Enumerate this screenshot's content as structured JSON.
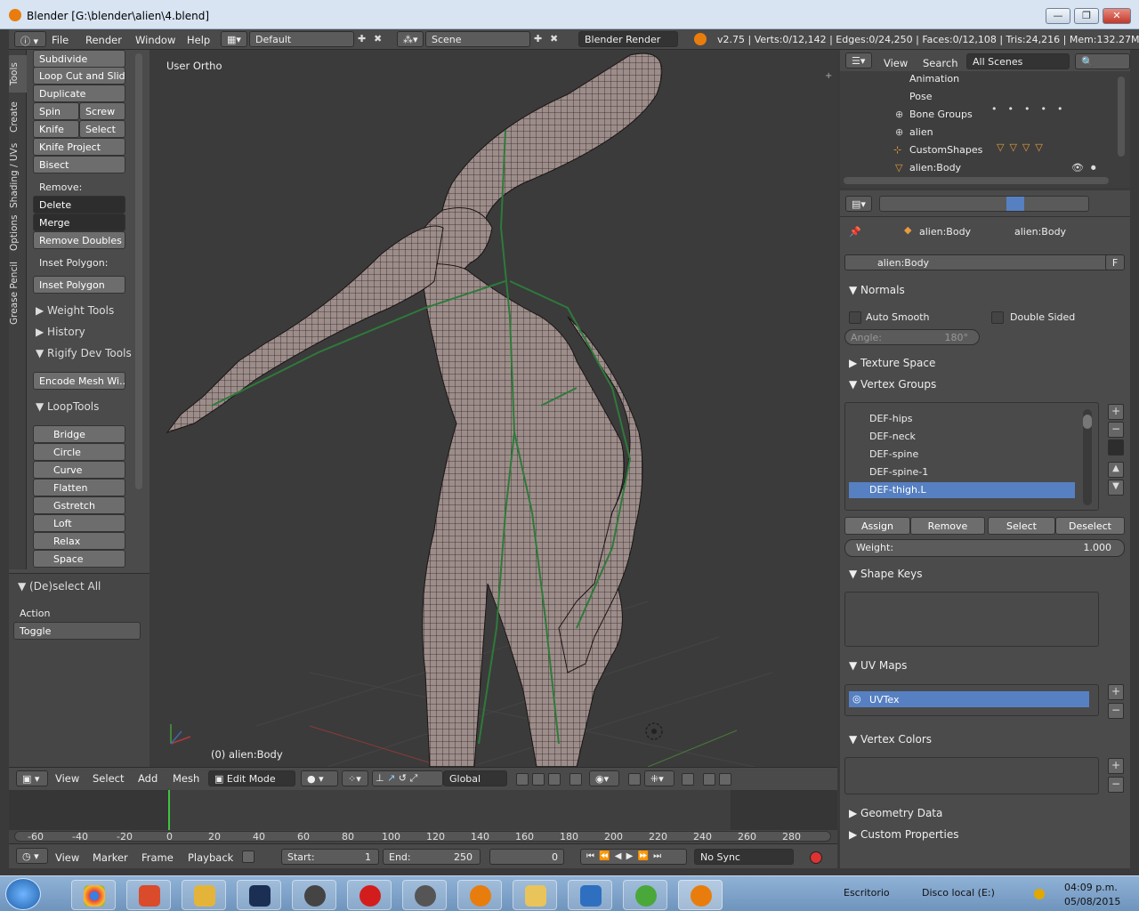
{
  "window": {
    "title": "Blender [G:\\blender\\alien\\4.blend]",
    "min": "—",
    "max": "❐",
    "close": "✕"
  },
  "topbar": {
    "menus": [
      "File",
      "Render",
      "Window",
      "Help"
    ],
    "screen_layout": "Default",
    "scene": "Scene",
    "engine": "Blender Render",
    "stats": "v2.75 | Verts:0/12,142 | Edges:0/24,250 | Faces:0/12,108 | Tris:24,216 | Mem:132.27M | al"
  },
  "tabs": [
    "Tools",
    "Create",
    "Shading / UVs",
    "Options",
    "Grease Pencil"
  ],
  "toolshelf": {
    "buttons": [
      "Subdivide",
      "Loop Cut and Slide",
      "Duplicate"
    ],
    "spin": "Spin",
    "screw": "Screw",
    "knife": "Knife",
    "select": "Select",
    "knife_project": "Knife Project",
    "bisect": "Bisect",
    "remove_label": "Remove:",
    "delete": "Delete",
    "merge": "Merge",
    "remove_doubles": "Remove Doubles",
    "inset_label": "Inset Polygon:",
    "inset_button": "Inset Polygon",
    "weight_tools": "Weight Tools",
    "history": "History",
    "rigify": "Rigify Dev Tools",
    "encode_mesh": "Encode Mesh Wi...",
    "looptools": "LoopTools",
    "looptools_items": [
      "Bridge",
      "Circle",
      "Curve",
      "Flatten",
      "Gstretch",
      "Loft",
      "Relax",
      "Space"
    ],
    "deselect_all": "(De)select All",
    "action_label": "Action",
    "action_value": "Toggle"
  },
  "viewport": {
    "view_label": "User Ortho",
    "object_label": "(0) alien:Body"
  },
  "view3d_header": {
    "menus": [
      "View",
      "Select",
      "Add",
      "Mesh"
    ],
    "mode": "Edit Mode",
    "orientation": "Global"
  },
  "timeline": {
    "ticks": [
      "-60",
      "-40",
      "-20",
      "0",
      "20",
      "40",
      "60",
      "80",
      "100",
      "120",
      "140",
      "160",
      "180",
      "200",
      "220",
      "240",
      "260",
      "280"
    ],
    "menus": [
      "View",
      "Marker",
      "Frame",
      "Playback"
    ],
    "start_label": "Start:",
    "start": "1",
    "end_label": "End:",
    "end": "250",
    "current": "0",
    "sync": "No Sync"
  },
  "outliner": {
    "menus": [
      "View",
      "Search"
    ],
    "filter": "All Scenes",
    "rows": [
      "Animation",
      "Pose",
      "Bone Groups",
      "alien",
      "CustomShapes",
      "alien:Body"
    ]
  },
  "properties": {
    "breadcrumb_object": "alien:Body",
    "breadcrumb_data": "alien:Body",
    "datablock": "alien:Body",
    "fake_user": "F",
    "normals": "Normals",
    "auto_smooth": "Auto Smooth",
    "double_sided": "Double Sided",
    "angle_label": "Angle:",
    "angle_value": "180°",
    "texture_space": "Texture Space",
    "vertex_groups": "Vertex Groups",
    "groups": [
      "DEF-hips",
      "DEF-neck",
      "DEF-spine",
      "DEF-spine-1",
      "DEF-thigh.L"
    ],
    "assign": "Assign",
    "remove": "Remove",
    "select": "Select",
    "deselect": "Deselect",
    "weight_label": "Weight:",
    "weight_value": "1.000",
    "shape_keys": "Shape Keys",
    "uv_maps": "UV Maps",
    "uv_item": "UVTex",
    "vertex_colors": "Vertex Colors",
    "geometry_data": "Geometry Data",
    "custom_properties": "Custom Properties"
  },
  "taskbar": {
    "escritorio": "Escritorio",
    "disco": "Disco local (E:)",
    "time": "04:09 p.m.",
    "date": "05/08/2015"
  },
  "colors": {
    "accent": "#5680c2",
    "mesh": "#9d8d8a",
    "bones": "#2e7a3a"
  }
}
